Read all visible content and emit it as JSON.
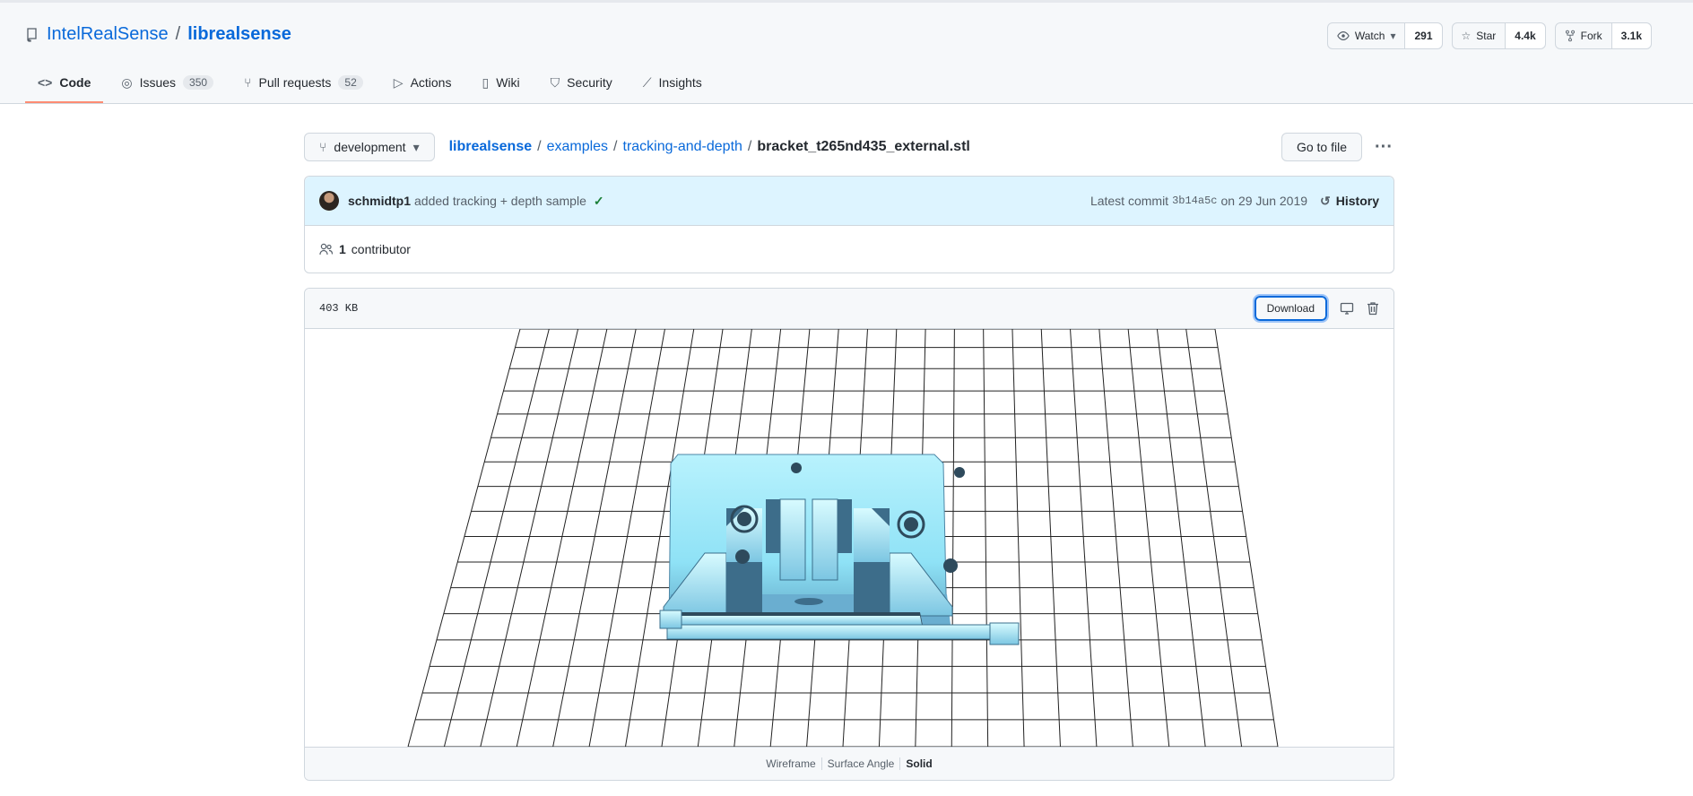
{
  "repo": {
    "owner": "IntelRealSense",
    "name": "librealsense"
  },
  "actions": {
    "watch": {
      "label": "Watch",
      "count": "291"
    },
    "star": {
      "label": "Star",
      "count": "4.4k"
    },
    "fork": {
      "label": "Fork",
      "count": "3.1k"
    }
  },
  "tabs": [
    {
      "label": "Code",
      "icon": "code-icon"
    },
    {
      "label": "Issues",
      "count": "350",
      "icon": "issue-icon"
    },
    {
      "label": "Pull requests",
      "count": "52",
      "icon": "pr-icon"
    },
    {
      "label": "Actions",
      "icon": "play-icon"
    },
    {
      "label": "Wiki",
      "icon": "book-icon"
    },
    {
      "label": "Security",
      "icon": "shield-icon"
    },
    {
      "label": "Insights",
      "icon": "graph-icon"
    }
  ],
  "branch": "development",
  "breadcrumb": {
    "repo": "librealsense",
    "dir1": "examples",
    "dir2": "tracking-and-depth",
    "file": "bracket_t265nd435_external.stl"
  },
  "goto_file": "Go to file",
  "commit": {
    "author": "schmidtp1",
    "message": "added tracking + depth sample",
    "latest_label": "Latest commit",
    "sha": "3b14a5c",
    "date": "on 29 Jun 2019",
    "history": "History"
  },
  "contributors": {
    "count": "1",
    "label": "contributor"
  },
  "file": {
    "size": "403 KB",
    "download": "Download"
  },
  "view_modes": [
    "Wireframe",
    "Surface Angle",
    "Solid"
  ],
  "active_view_mode": "Solid",
  "colors": {
    "link": "#0969da",
    "accent_tab": "#fd8c73",
    "model": "#9ee8f8"
  }
}
